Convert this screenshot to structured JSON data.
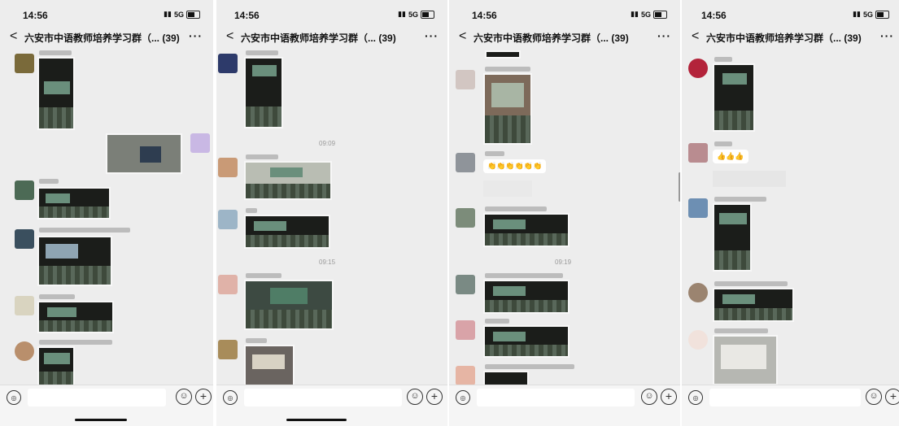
{
  "phones": [
    {
      "time": "14:56",
      "signal": "5G",
      "chat_title": "六安市中语教师培养学习群（...",
      "member_count": "(39)",
      "more_label": "···",
      "back_label": "<"
    },
    {
      "time": "14:56",
      "signal": "5G",
      "chat_title": "六安市中语教师培养学习群（...",
      "member_count": "(39)",
      "more_label": "···",
      "back_label": "<"
    },
    {
      "time": "14:56",
      "signal": "5G",
      "chat_title": "六安市中语教师培养学习群（...",
      "member_count": "(39)",
      "more_label": "···",
      "back_label": "<"
    },
    {
      "time": "14:56",
      "signal": "5G",
      "chat_title": "六安市中语教师培养学习群（...",
      "member_count": "(39)",
      "more_label": "···",
      "back_label": "<"
    }
  ],
  "timestamps": {
    "p2_a": "09:09",
    "p2_b": "09:15",
    "p3_a": "09:19"
  },
  "bubbles": {
    "p3_emoji": "👏👏👏👏👏👏",
    "p4_thumbs": "👍👍👍"
  },
  "input": {
    "voice_icon": "voice-icon",
    "emoji_icon": "emoji-icon",
    "plus_icon": "plus-icon"
  }
}
